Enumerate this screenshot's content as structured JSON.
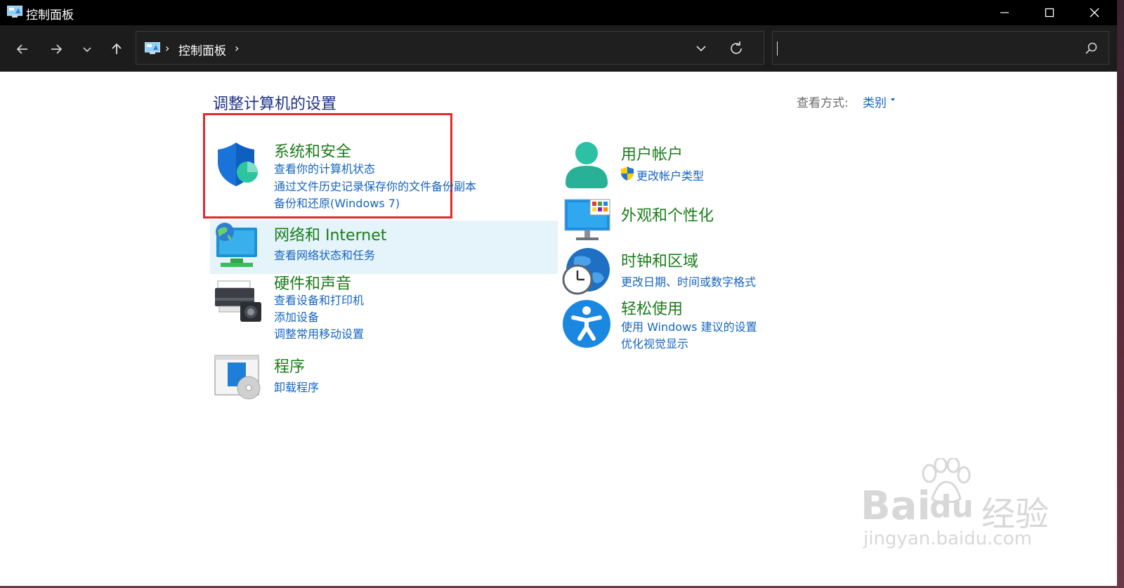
{
  "window": {
    "title": "控制面板",
    "controls": {
      "minimize": "minimize-icon",
      "maximize": "maximize-icon",
      "close": "close-icon"
    }
  },
  "navbar": {
    "breadcrumb": [
      "控制面板"
    ],
    "search": {
      "value": "",
      "placeholder": ""
    }
  },
  "content": {
    "heading": "调整计算机的设置",
    "view_by_label": "查看方式:",
    "view_by_value": "类别",
    "left_categories": [
      {
        "title": "系统和安全",
        "icon": "shield-icon",
        "links": [
          "查看你的计算机状态",
          "通过文件历史记录保存你的文件备份副本",
          "备份和还原(Windows 7)"
        ]
      },
      {
        "title": "网络和 Internet",
        "icon": "network-icon",
        "links": [
          "查看网络状态和任务"
        ]
      },
      {
        "title": "硬件和声音",
        "icon": "printer-icon",
        "links": [
          "查看设备和打印机",
          "添加设备",
          "调整常用移动设置"
        ]
      },
      {
        "title": "程序",
        "icon": "programs-icon",
        "links": [
          "卸载程序"
        ]
      }
    ],
    "right_categories": [
      {
        "title": "用户帐户",
        "icon": "user-icon",
        "links": [
          "更改帐户类型"
        ]
      },
      {
        "title": "外观和个性化",
        "icon": "monitor-icon",
        "links": []
      },
      {
        "title": "时钟和区域",
        "icon": "clock-globe-icon",
        "links": [
          "更改日期、时间或数字格式"
        ]
      },
      {
        "title": "轻松使用",
        "icon": "accessibility-icon",
        "links": [
          "使用 Windows 建议的设置",
          "优化视觉显示"
        ]
      }
    ]
  },
  "watermark": {
    "brand_a": "Bai",
    "brand_b": "du",
    "brand_cn": "经验",
    "url": "jingyan.baidu.com"
  },
  "colors": {
    "title_green": "#1b7d1b",
    "link_blue": "#1565c0",
    "heading_blue": "#1e3287",
    "hover_bg": "#e5f3fb",
    "annotation_red": "#e02b2b"
  }
}
